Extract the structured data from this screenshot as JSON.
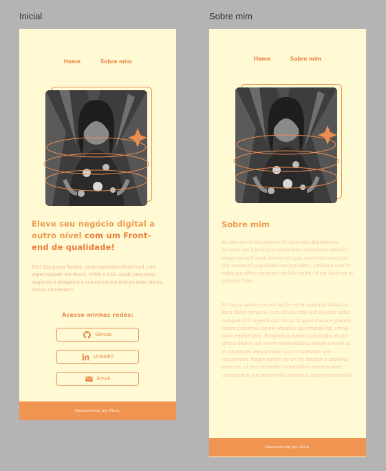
{
  "frames": {
    "inicial": {
      "label": "Inicial",
      "nav": {
        "home": "Home",
        "about": "Sobre mim"
      },
      "hero": {
        "title_part1": "Eleve seu negócio digital a outro nível ",
        "title_part2": "com um Front-end de qualidade!",
        "intro": "Olá! Sou Joana Santos, desenvolvedora Front-end com especialidade em React, HTML e CSS. Ajudo pequenos negócios e designers a colocarem em prática boas ideias. Vamos conversar?"
      },
      "social": {
        "title": "Acesse minhas redes:",
        "buttons": [
          {
            "label": "GitHub",
            "icon": "github-icon"
          },
          {
            "label": "Linkedin",
            "icon": "linkedin-icon"
          },
          {
            "label": "Email",
            "icon": "email-icon"
          }
        ]
      },
      "footer": "Desenvolvido por Alura."
    },
    "sobre": {
      "label": "Sobre mim",
      "nav": {
        "home": "Home",
        "about": "Sobre mim"
      },
      "about_title": "Sobre mim",
      "paragraph1": "At vero eos et accusamus et iusto odio dignissimos ducimus qui blanditiis praesentium voluptatum deleniti atque corrupti quos dolores et quas molestias excepturi sint occaecati cupiditate non provident, similique sunt in culpa qui officia deserunt mollitia animi, id est laborum et dolorum fuga.",
      "paragraph2": "Et harum quidem rerum facilis est et expedita distinctio. Nam libero tempore, cum soluta nobis est eligendi optio cumque nihil impedit quo minus id quod maxime placeat facere possimus, omnis voluptas assumenda est, omnis dolor repellendus. Temporibus autem quibusdam et aut officiis debitis aut rerum necessitatibus saepe eveniet ut et voluptates repudiandae sint et molestiae non recusandae. Itaque earum rerum hic tenetur a sapiente delectus, ut aut reiciendis voluptatibus maiores alias consequatur aut perferendis doloribus asperiores repellat.",
      "footer": "Desenvolvido por Alura."
    }
  },
  "colors": {
    "canvas": "#b4b4b4",
    "page": "#fff9d4",
    "accent": "#ec8d52",
    "footer": "#ef9451"
  }
}
